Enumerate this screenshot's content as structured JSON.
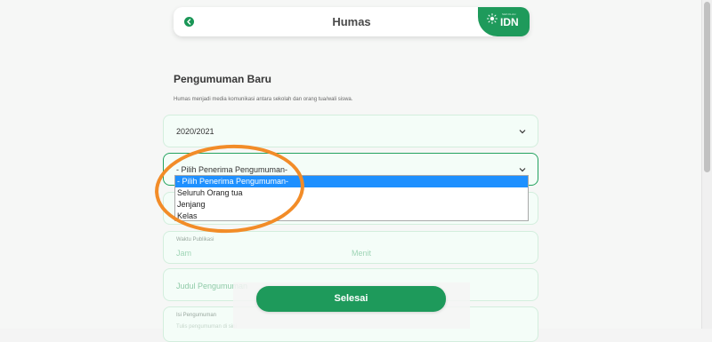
{
  "header": {
    "title": "Humas",
    "brand_small": "SEKOLAH",
    "brand_text": "IDN"
  },
  "section": {
    "title": "Pengumuman Baru",
    "description": "Humas menjadi media komunikasi antara sekolah dan orang tua/wali siswa."
  },
  "form": {
    "year_value": "2020/2021",
    "recipient_value": "- Pilih Penerima Pengumuman-",
    "publish_time_label": "Waktu Publikasi",
    "hour_placeholder": "Jam",
    "minute_placeholder": "Menit",
    "title_placeholder": "Judul Pengumuman",
    "content_label": "Isi Pengumuman",
    "content_placeholder": "Tulis pengumuman di sini"
  },
  "dropdown": {
    "options": [
      "- Pilih Penerima Pengumuman-",
      "Seluruh Orang tua",
      "Jenjang",
      "Kelas"
    ],
    "selected_index": 0
  },
  "actions": {
    "submit_label": "Selesai"
  },
  "colors": {
    "primary": "#1e9a5b",
    "selection": "#1e90ff",
    "annotation": "#f28c28"
  },
  "icons": {
    "back": "chevron-left-icon",
    "dropdown": "chevron-down-icon",
    "logo": "sun-icon"
  }
}
